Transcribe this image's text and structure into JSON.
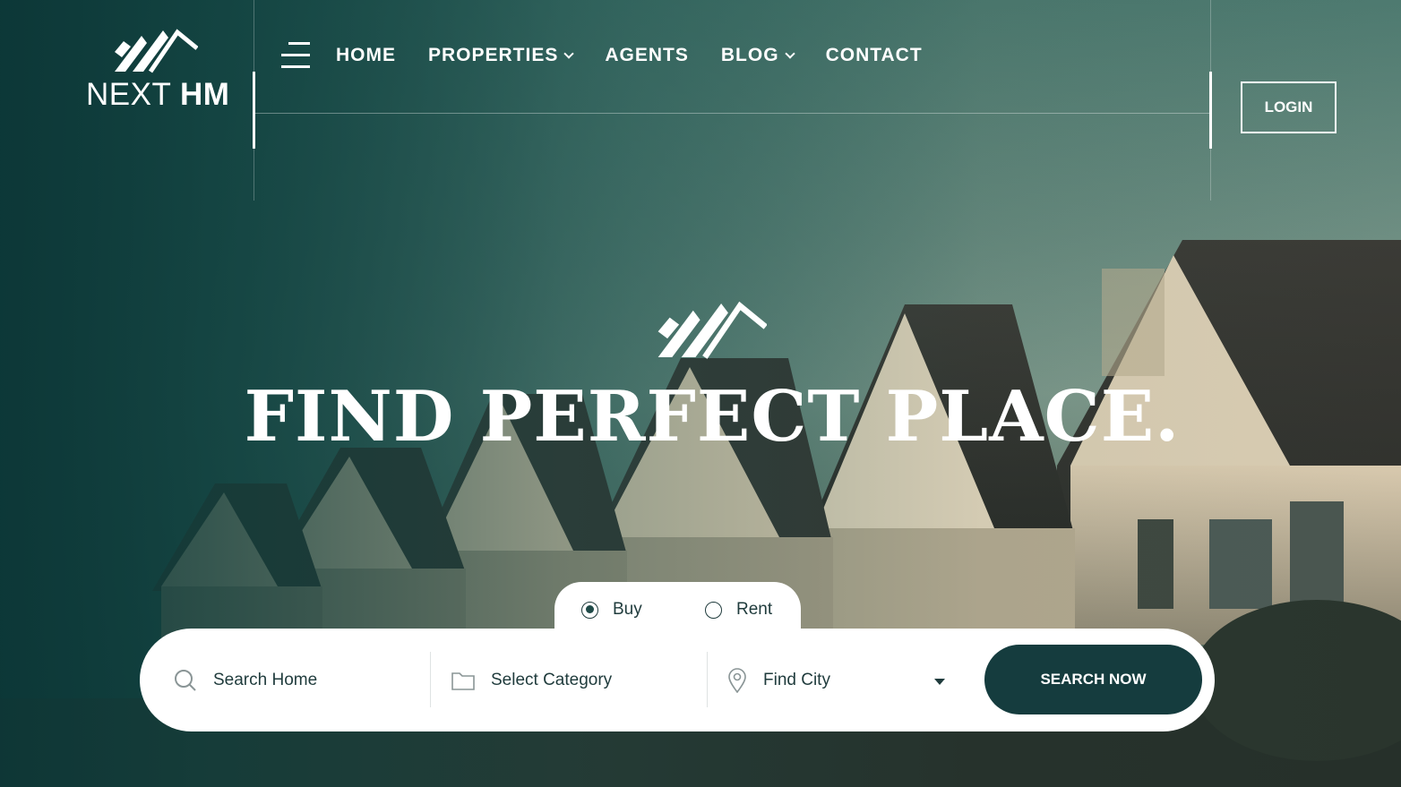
{
  "header": {
    "logo": {
      "word1": "NEXT",
      "word2": "HM"
    },
    "nav": [
      {
        "label": "HOME",
        "has_dropdown": false
      },
      {
        "label": "PROPERTIES",
        "has_dropdown": true
      },
      {
        "label": "AGENTS",
        "has_dropdown": false
      },
      {
        "label": "BLOG",
        "has_dropdown": true
      },
      {
        "label": "CONTACT",
        "has_dropdown": false
      }
    ],
    "login_label": "LOGIN"
  },
  "hero": {
    "headline": "FIND PERFECT PLACE."
  },
  "search": {
    "tabs": [
      {
        "label": "Buy",
        "checked": true
      },
      {
        "label": "Rent",
        "checked": false
      }
    ],
    "home_placeholder": "Search Home",
    "category_placeholder": "Select Category",
    "city_placeholder": "Find City",
    "button_label": "SEARCH NOW"
  },
  "colors": {
    "brand_dark": "#153c3e",
    "text_dark": "#1f3b3c",
    "white": "#ffffff"
  },
  "icons": [
    "menu-icon",
    "search-icon",
    "folder-icon",
    "location-pin-icon",
    "chevron-down-icon",
    "roof-logo-icon"
  ]
}
